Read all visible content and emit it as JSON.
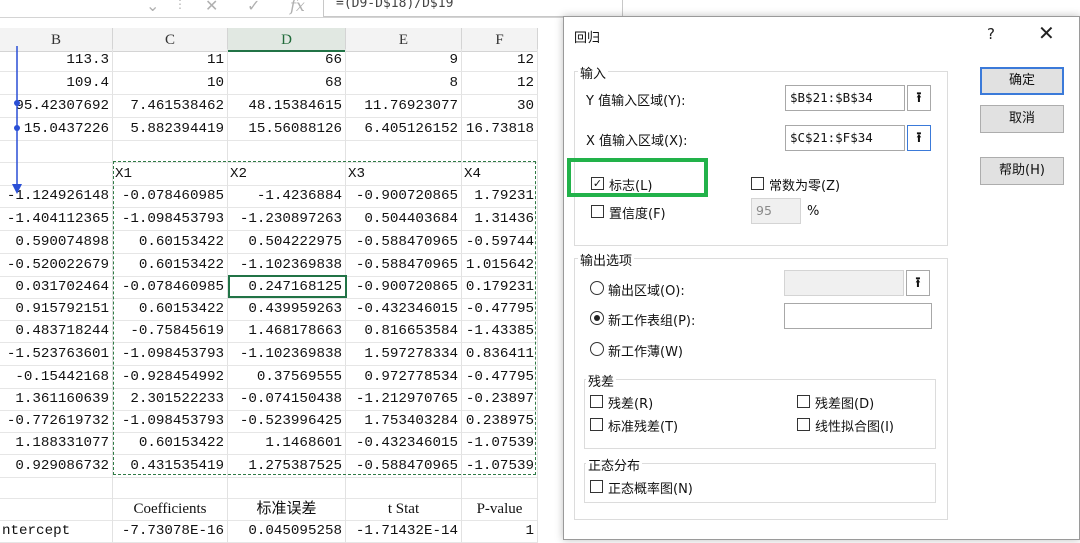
{
  "formula_bar": {
    "formula": "=(D9-D$18)/D$19",
    "fx": "fx"
  },
  "columns": [
    "B",
    "C",
    "D",
    "E",
    "F"
  ],
  "selected_column": "D",
  "rows": [
    [
      "113.3",
      "11",
      "66",
      "9",
      "12"
    ],
    [
      "109.4",
      "10",
      "68",
      "8",
      "12"
    ],
    [
      "95.42307692",
      "7.461538462",
      "48.15384615",
      "11.76923077",
      "30"
    ],
    [
      "15.0437226",
      "5.882394419",
      "15.56088126",
      "6.405126152",
      "16.73818"
    ],
    [
      "",
      "",
      "",
      "",
      ""
    ],
    [
      "",
      "X1",
      "X2",
      "X3",
      "X4"
    ],
    [
      "-1.124926148",
      "-0.078460985",
      "-1.4236884",
      "-0.900720865",
      "1.79231"
    ],
    [
      "-1.404112365",
      "-1.098453793",
      "-1.230897263",
      "0.504403684",
      "1.31436"
    ],
    [
      "0.590074898",
      "0.60153422",
      "0.504222975",
      "-0.588470965",
      "-0.59744"
    ],
    [
      "-0.520022679",
      "0.60153422",
      "-1.102369838",
      "-0.588470965",
      "1.015642"
    ],
    [
      "0.031702464",
      "-0.078460985",
      "0.247168125",
      "-0.900720865",
      "0.179231"
    ],
    [
      "0.915792151",
      "0.60153422",
      "0.439959263",
      "-0.432346015",
      "-0.47795"
    ],
    [
      "0.483718244",
      "-0.75845619",
      "1.468178663",
      "0.816653584",
      "-1.43385"
    ],
    [
      "-1.523763601",
      "-1.098453793",
      "-1.102369838",
      "1.597278334",
      "0.836411"
    ],
    [
      "-0.15442168",
      "-0.928454992",
      "0.37569555",
      "0.972778534",
      "-0.47795"
    ],
    [
      "1.361160639",
      "2.301522233",
      "-0.074150438",
      "-1.212970765",
      "-0.23897"
    ],
    [
      "-0.772619732",
      "-1.098453793",
      "-0.523996425",
      "1.753403284",
      "0.238975"
    ],
    [
      "1.188331077",
      "0.60153422",
      "1.1468601",
      "-0.432346015",
      "-1.07539"
    ],
    [
      "0.929086732",
      "0.431535419",
      "1.275387525",
      "-0.588470965",
      "-1.07539"
    ],
    [
      "",
      "",
      "",
      "",
      ""
    ],
    [
      "",
      "Coefficients",
      "标准误差",
      "t Stat",
      "P-value"
    ],
    [
      "ntercept",
      "-7.73078E-16",
      "0.045095258",
      "-1.71432E-14",
      "1"
    ]
  ],
  "dialog": {
    "title": "回归",
    "help_glyph": "?",
    "close_glyph": "✕",
    "input_group": "输入",
    "y_label": "Y 值输入区域(Y):",
    "y_value": "$B$21:$B$34",
    "x_label": "X 值输入区域(X):",
    "x_value": "$C$21:$F$34",
    "labels_check": "标志(L)",
    "labels_checked": true,
    "const_zero": "常数为零(Z)",
    "confidence": "置信度(F)",
    "confidence_value": "95",
    "percent": "%",
    "output_group": "输出选项",
    "out_range": "输出区域(O):",
    "new_sheet": "新工作表组(P):",
    "new_book": "新工作薄(W)",
    "residual_group": "残差",
    "residuals": "残差(R)",
    "residual_plot": "残差图(D)",
    "std_residuals": "标准残差(T)",
    "line_fit": "线性拟合图(I)",
    "normal_group": "正态分布",
    "normal_plot": "正态概率图(N)",
    "ok": "确定",
    "cancel": "取消",
    "help": "帮助(H)",
    "picker_glyph": "⭱",
    "check_glyph": "✓"
  }
}
